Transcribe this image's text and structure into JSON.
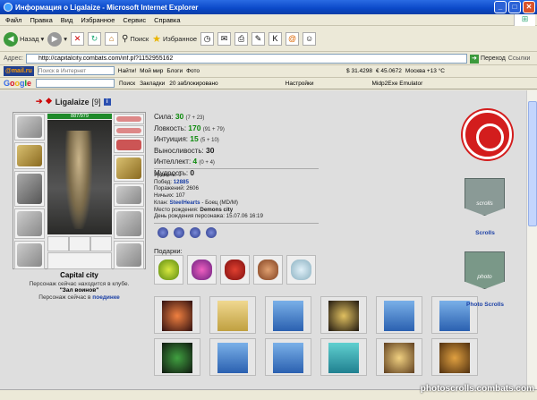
{
  "window": {
    "title": "Информация о Ligalaize - Microsoft Internet Explorer"
  },
  "menu": [
    "Файл",
    "Правка",
    "Вид",
    "Избранное",
    "Сервис",
    "Справка"
  ],
  "toolbar": {
    "back": "Назад",
    "search": "Поиск",
    "favorites": "Избранное"
  },
  "address": {
    "label": "Адрес:",
    "url": "http://capitalcity.combats.com/inf.pl?1152955162",
    "go": "Переход",
    "links": "Ссылки"
  },
  "mailbar": {
    "logo": "@mail.ru",
    "search_placeholder": "Поиск в Интернет",
    "find": "Найти!",
    "my_world": "Мой мир",
    "blogs": "Блоги",
    "photo": "Фото",
    "usd": "$ 31.4298",
    "eur": "€ 45.0672",
    "weather": "Москва +13 °C"
  },
  "googlebar": {
    "logo": "Google",
    "search": "Поиск",
    "bookmarks": "Закладки",
    "blocked": "20 заблокировано",
    "settings": "Настройки",
    "midp": "Midp2Exe Emulator"
  },
  "character": {
    "name": "Ligalaize",
    "level": "[9]",
    "hp": "887/979",
    "city": "Capital city",
    "location_line1": "Персонаж сейчас находится в клубе.",
    "location_room": "\"Зал воинов\"",
    "location_line3": "Персонаж сейчас в",
    "location_link": "поединке"
  },
  "stats": [
    {
      "label": "Сила:",
      "value": "30",
      "extra": "(7 + 23)"
    },
    {
      "label": "Ловкость:",
      "value": "170",
      "extra": "(91 + 79)"
    },
    {
      "label": "Интуиция:",
      "value": "15",
      "extra": "(5 + 10)"
    },
    {
      "label": "Выносливость:",
      "value": "30",
      "extra": ""
    },
    {
      "label": "Интеллект:",
      "value": "4",
      "extra": "(0 + 4)"
    },
    {
      "label": "Мудрость:",
      "value": "0",
      "extra": ""
    }
  ],
  "details": {
    "level": "Уровень: 9",
    "wins_label": "Побед:",
    "wins": "12885",
    "losses": "Поражений: 2606",
    "draws": "Ничьих: 107",
    "clan_label": "Клан:",
    "clan": "SteelHearts",
    "clan_role": "- Боец (MD/M)",
    "birthplace_label": "Место рождения:",
    "birthplace": "Demons city",
    "birthday": "День рождения персонажа: 15.07.06 16:19"
  },
  "gifts_label": "Подарки:",
  "sidebar": {
    "scrolls": "Scrolls",
    "scrolls_banner": "scrolls",
    "photo": "Photo Scrolls",
    "photo_banner": "photo"
  },
  "watermark": "photoscrolls.combats.com"
}
